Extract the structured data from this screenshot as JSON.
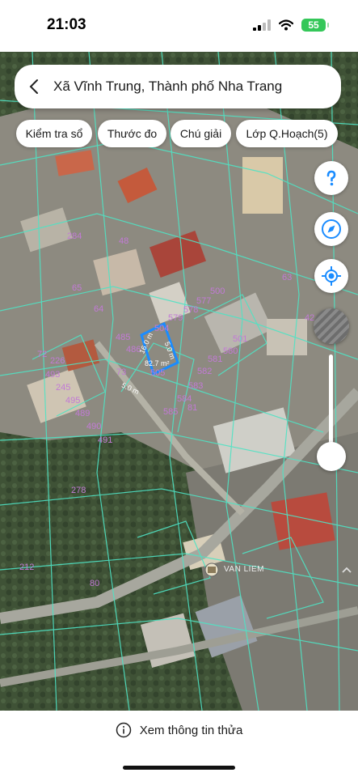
{
  "status_bar": {
    "time": "21:03",
    "battery": "55"
  },
  "search": {
    "location_title": "Xã Vĩnh Trung, Thành phố Nha Trang"
  },
  "chips": [
    {
      "label": "Kiểm tra sổ"
    },
    {
      "label": "Thước đo"
    },
    {
      "label": "Chú giải"
    },
    {
      "label": "Lớp Q.Hoạch(5)"
    }
  ],
  "map": {
    "parcel_numbers": [
      "284",
      "48",
      "65",
      "64",
      "63",
      "500",
      "577",
      "578",
      "579",
      "504",
      "485",
      "486",
      "73",
      "72",
      "226",
      "493",
      "245",
      "495",
      "489",
      "490",
      "491",
      "505",
      "501",
      "580",
      "581",
      "582",
      "583",
      "584",
      "585",
      "81",
      "42",
      "278",
      "212",
      "80"
    ],
    "selected_parcel": {
      "edge_labels": [
        "16.0 m",
        "5.0 m",
        "5.0 m"
      ],
      "area_label": "82.7 m²"
    },
    "place_label": "VAN LIEM",
    "accent_color": "#1a8cff",
    "parcel_line_color": "#4fe3c4",
    "parcel_number_color": "#c27ad6"
  },
  "bottom": {
    "info_link": "Xem thông tin thửa"
  }
}
